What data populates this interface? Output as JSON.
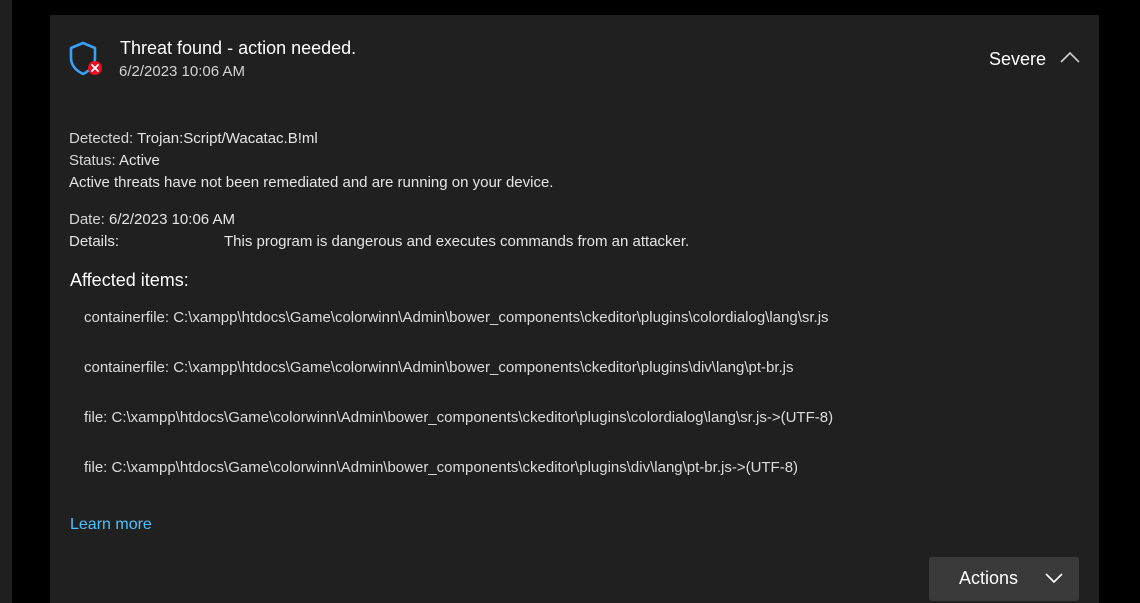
{
  "threat": {
    "title": "Threat found - action needed.",
    "timestamp": "6/2/2023 10:06 AM",
    "severity": "Severe"
  },
  "summary": {
    "detected_label": "Detected:",
    "detected_value": "Trojan:Script/Wacatac.B!ml",
    "status_label": "Status:",
    "status_value": "Active",
    "status_note": "Active threats have not been remediated and are running on your device.",
    "date_label": "Date:",
    "date_value": "6/2/2023 10:06 AM",
    "details_label": "Details:",
    "details_value": "This program is dangerous and executes commands from an attacker."
  },
  "affected": {
    "heading": "Affected items:",
    "items": [
      "containerfile: C:\\xampp\\htdocs\\Game\\colorwinn\\Admin\\bower_components\\ckeditor\\plugins\\colordialog\\lang\\sr.js",
      "containerfile: C:\\xampp\\htdocs\\Game\\colorwinn\\Admin\\bower_components\\ckeditor\\plugins\\div\\lang\\pt-br.js",
      "file: C:\\xampp\\htdocs\\Game\\colorwinn\\Admin\\bower_components\\ckeditor\\plugins\\colordialog\\lang\\sr.js->(UTF-8)",
      "file: C:\\xampp\\htdocs\\Game\\colorwinn\\Admin\\bower_components\\ckeditor\\plugins\\div\\lang\\pt-br.js->(UTF-8)"
    ]
  },
  "links": {
    "learn_more": "Learn more"
  },
  "actions": {
    "label": "Actions"
  },
  "icons": {
    "shield": "shield-error-icon",
    "collapse": "chevron-up-icon",
    "actions_dropdown": "chevron-down-icon"
  },
  "colors": {
    "accent_blue": "#4cc2ff",
    "shield_blue": "#3aa0f3",
    "error_red": "#e81123",
    "card_bg": "#202020",
    "button_bg": "#3a3a3a"
  }
}
